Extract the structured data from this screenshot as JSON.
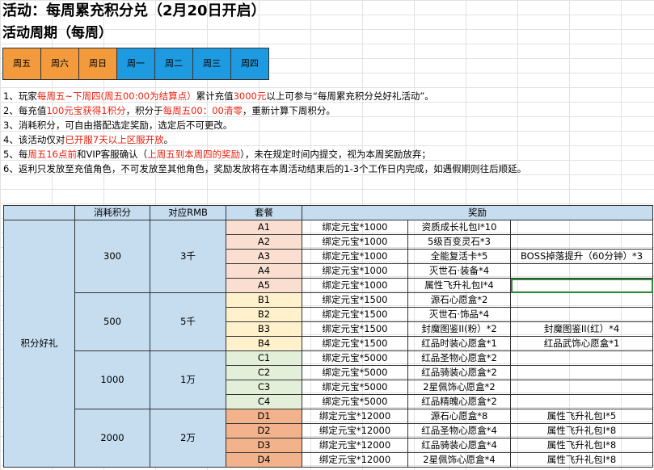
{
  "title": "活动：每周累充积分兑（2月20日开启）",
  "subtitle": "活动周期（每周）",
  "colors": {
    "orange": "#f39a3d",
    "blue": "#1e9be0",
    "red": "#e8200f"
  },
  "weekdays": [
    {
      "label": "周五",
      "color": "orange"
    },
    {
      "label": "周六",
      "color": "orange"
    },
    {
      "label": "周日",
      "color": "orange"
    },
    {
      "label": "周一",
      "color": "blue"
    },
    {
      "label": "周二",
      "color": "blue"
    },
    {
      "label": "周三",
      "color": "blue"
    },
    {
      "label": "周四",
      "color": "blue"
    }
  ],
  "rules": [
    [
      {
        "t": "1、玩家"
      },
      {
        "t": "每周五~下周四(周五00:00为结算点）",
        "red": true
      },
      {
        "t": "累计充值"
      },
      {
        "t": "3000元",
        "red": true
      },
      {
        "t": "以上可参与“每周累充积分兑好礼活动”。"
      }
    ],
    [
      {
        "t": "2、每充值"
      },
      {
        "t": "100元宝获得1积分",
        "red": true
      },
      {
        "t": "，积分于"
      },
      {
        "t": "每周五00：00清零",
        "red": true
      },
      {
        "t": "，重新计算下周积分。"
      }
    ],
    [
      {
        "t": "3、消耗积分，可自由搭配选定奖励，选定后不可更改。"
      }
    ],
    [
      {
        "t": "4、该活动仅对"
      },
      {
        "t": "已开服7天以上区服开放",
        "red": true
      },
      {
        "t": "。"
      }
    ],
    [
      {
        "t": "5、每"
      },
      {
        "t": "周五16点前",
        "red": true
      },
      {
        "t": "和VIP客服确认（"
      },
      {
        "t": "上周五到本周四的奖励",
        "red": true
      },
      {
        "t": "），未在规定时间内提交，视为本周奖励放弃；"
      }
    ],
    [
      {
        "t": "6、返利只发放至充值角色，不可发放至其他角色，奖励发放将在本周活动结束后的1-3个工作日内完成，如遇假期则往后顺延。"
      }
    ]
  ],
  "table": {
    "headers": {
      "points": "消耗积分",
      "rmb": "对应RMB",
      "package": "套餐",
      "reward": "奖励"
    },
    "category": "积分好礼",
    "groups": [
      {
        "points": "300",
        "rmb": "3千",
        "color": "A",
        "rows": [
          {
            "pkg": "A1",
            "r1": "绑定元宝*1000",
            "r2": "资质成长礼包I*10",
            "r3": ""
          },
          {
            "pkg": "A2",
            "r1": "绑定元宝*1000",
            "r2": "5级百变灵石*3",
            "r3": ""
          },
          {
            "pkg": "A3",
            "r1": "绑定元宝*1000",
            "r2": "全能复活卡*5",
            "r3": "BOSS掉落提升（60分钟）*3"
          },
          {
            "pkg": "A4",
            "r1": "绑定元宝*1000",
            "r2": "灭世石·装备*4",
            "r3": ""
          },
          {
            "pkg": "A5",
            "r1": "绑定元宝*1000",
            "r2": "属性飞升礼包I*4",
            "r3": "",
            "sel": true
          }
        ]
      },
      {
        "points": "500",
        "rmb": "5千",
        "color": "B",
        "rows": [
          {
            "pkg": "B1",
            "r1": "绑定元宝*1500",
            "r2": "源石心愿盒*2",
            "r3": ""
          },
          {
            "pkg": "B2",
            "r1": "绑定元宝*1500",
            "r2": "灭世石·饰品*4",
            "r3": ""
          },
          {
            "pkg": "B3",
            "r1": "绑定元宝*1500",
            "r2": "封魔图鉴II(粉）*2",
            "r3": "封魔图鉴II(红）*4"
          },
          {
            "pkg": "B4",
            "r1": "绑定元宝*1500",
            "r2": "红品时装心愿盒*1",
            "r3": "红品武饰心愿盒*1"
          }
        ]
      },
      {
        "points": "1000",
        "rmb": "1万",
        "color": "C",
        "rows": [
          {
            "pkg": "C1",
            "r1": "绑定元宝*5000",
            "r2": "红品圣物心愿盒*2",
            "r3": ""
          },
          {
            "pkg": "C2",
            "r1": "绑定元宝*5000",
            "r2": "红品骑装心愿盒*2",
            "r3": ""
          },
          {
            "pkg": "C3",
            "r1": "绑定元宝*5000",
            "r2": "2星佩饰心愿盒*2",
            "r3": ""
          },
          {
            "pkg": "C4",
            "r1": "绑定元宝*5000",
            "r2": "红品精魄心愿盒*2",
            "r3": ""
          }
        ]
      },
      {
        "points": "2000",
        "rmb": "2万",
        "color": "D",
        "rows": [
          {
            "pkg": "D1",
            "r1": "绑定元宝*12000",
            "r2": "源石心愿盒*8",
            "r3": "属性飞升礼包I*5"
          },
          {
            "pkg": "D2",
            "r1": "绑定元宝*12000",
            "r2": "红品圣物心愿盒*4",
            "r3": "属性飞升礼包I*8"
          },
          {
            "pkg": "D3",
            "r1": "绑定元宝*12000",
            "r2": "红品骑装心愿盒*4",
            "r3": "属性飞升礼包I*8"
          },
          {
            "pkg": "D4",
            "r1": "绑定元宝*12000",
            "r2": "2星佩饰心愿盒*4",
            "r3": "属性飞升礼包I*8"
          }
        ]
      }
    ]
  }
}
